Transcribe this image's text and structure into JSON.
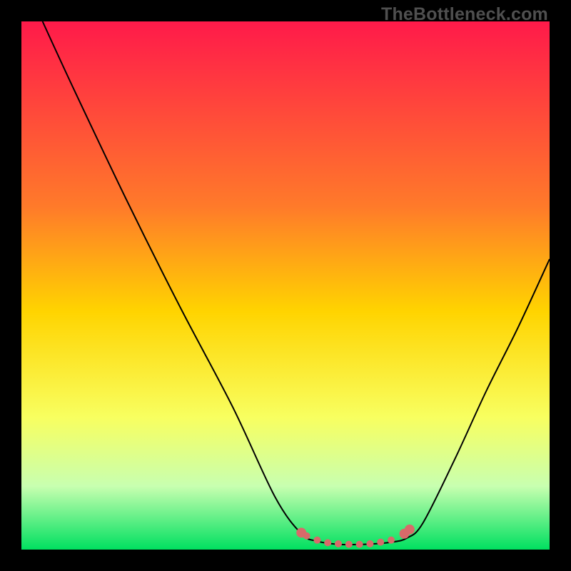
{
  "watermark": "TheBottleneck.com",
  "chart_data": {
    "type": "line",
    "title": "",
    "xlabel": "",
    "ylabel": "",
    "xlim": [
      0,
      100
    ],
    "ylim": [
      0,
      100
    ],
    "gradient_stops": [
      {
        "offset": 0,
        "color": "#ff1a4a"
      },
      {
        "offset": 35,
        "color": "#ff7a2a"
      },
      {
        "offset": 55,
        "color": "#ffd400"
      },
      {
        "offset": 75,
        "color": "#f8ff60"
      },
      {
        "offset": 88,
        "color": "#c8ffb0"
      },
      {
        "offset": 100,
        "color": "#00e060"
      }
    ],
    "series": [
      {
        "name": "curve",
        "stroke": "#000000",
        "points": [
          {
            "x": 4,
            "y": 100
          },
          {
            "x": 10,
            "y": 87
          },
          {
            "x": 20,
            "y": 66
          },
          {
            "x": 30,
            "y": 46
          },
          {
            "x": 40,
            "y": 27
          },
          {
            "x": 48,
            "y": 10
          },
          {
            "x": 53,
            "y": 3
          },
          {
            "x": 56,
            "y": 1.6
          },
          {
            "x": 60,
            "y": 1.0
          },
          {
            "x": 65,
            "y": 1.0
          },
          {
            "x": 70,
            "y": 1.4
          },
          {
            "x": 73,
            "y": 2.2
          },
          {
            "x": 76,
            "y": 5
          },
          {
            "x": 82,
            "y": 17
          },
          {
            "x": 88,
            "y": 30
          },
          {
            "x": 94,
            "y": 42
          },
          {
            "x": 100,
            "y": 55
          }
        ]
      },
      {
        "name": "bottom-dots",
        "stroke": "#d86a6a",
        "points": [
          {
            "x": 53,
            "y": 3.2
          },
          {
            "x": 54,
            "y": 2.6
          },
          {
            "x": 56,
            "y": 1.8
          },
          {
            "x": 58,
            "y": 1.3
          },
          {
            "x": 60,
            "y": 1.1
          },
          {
            "x": 62,
            "y": 1.0
          },
          {
            "x": 64,
            "y": 1.0
          },
          {
            "x": 66,
            "y": 1.1
          },
          {
            "x": 68,
            "y": 1.4
          },
          {
            "x": 70,
            "y": 1.8
          },
          {
            "x": 72.5,
            "y": 3.0
          },
          {
            "x": 73.5,
            "y": 3.8
          }
        ]
      }
    ]
  }
}
